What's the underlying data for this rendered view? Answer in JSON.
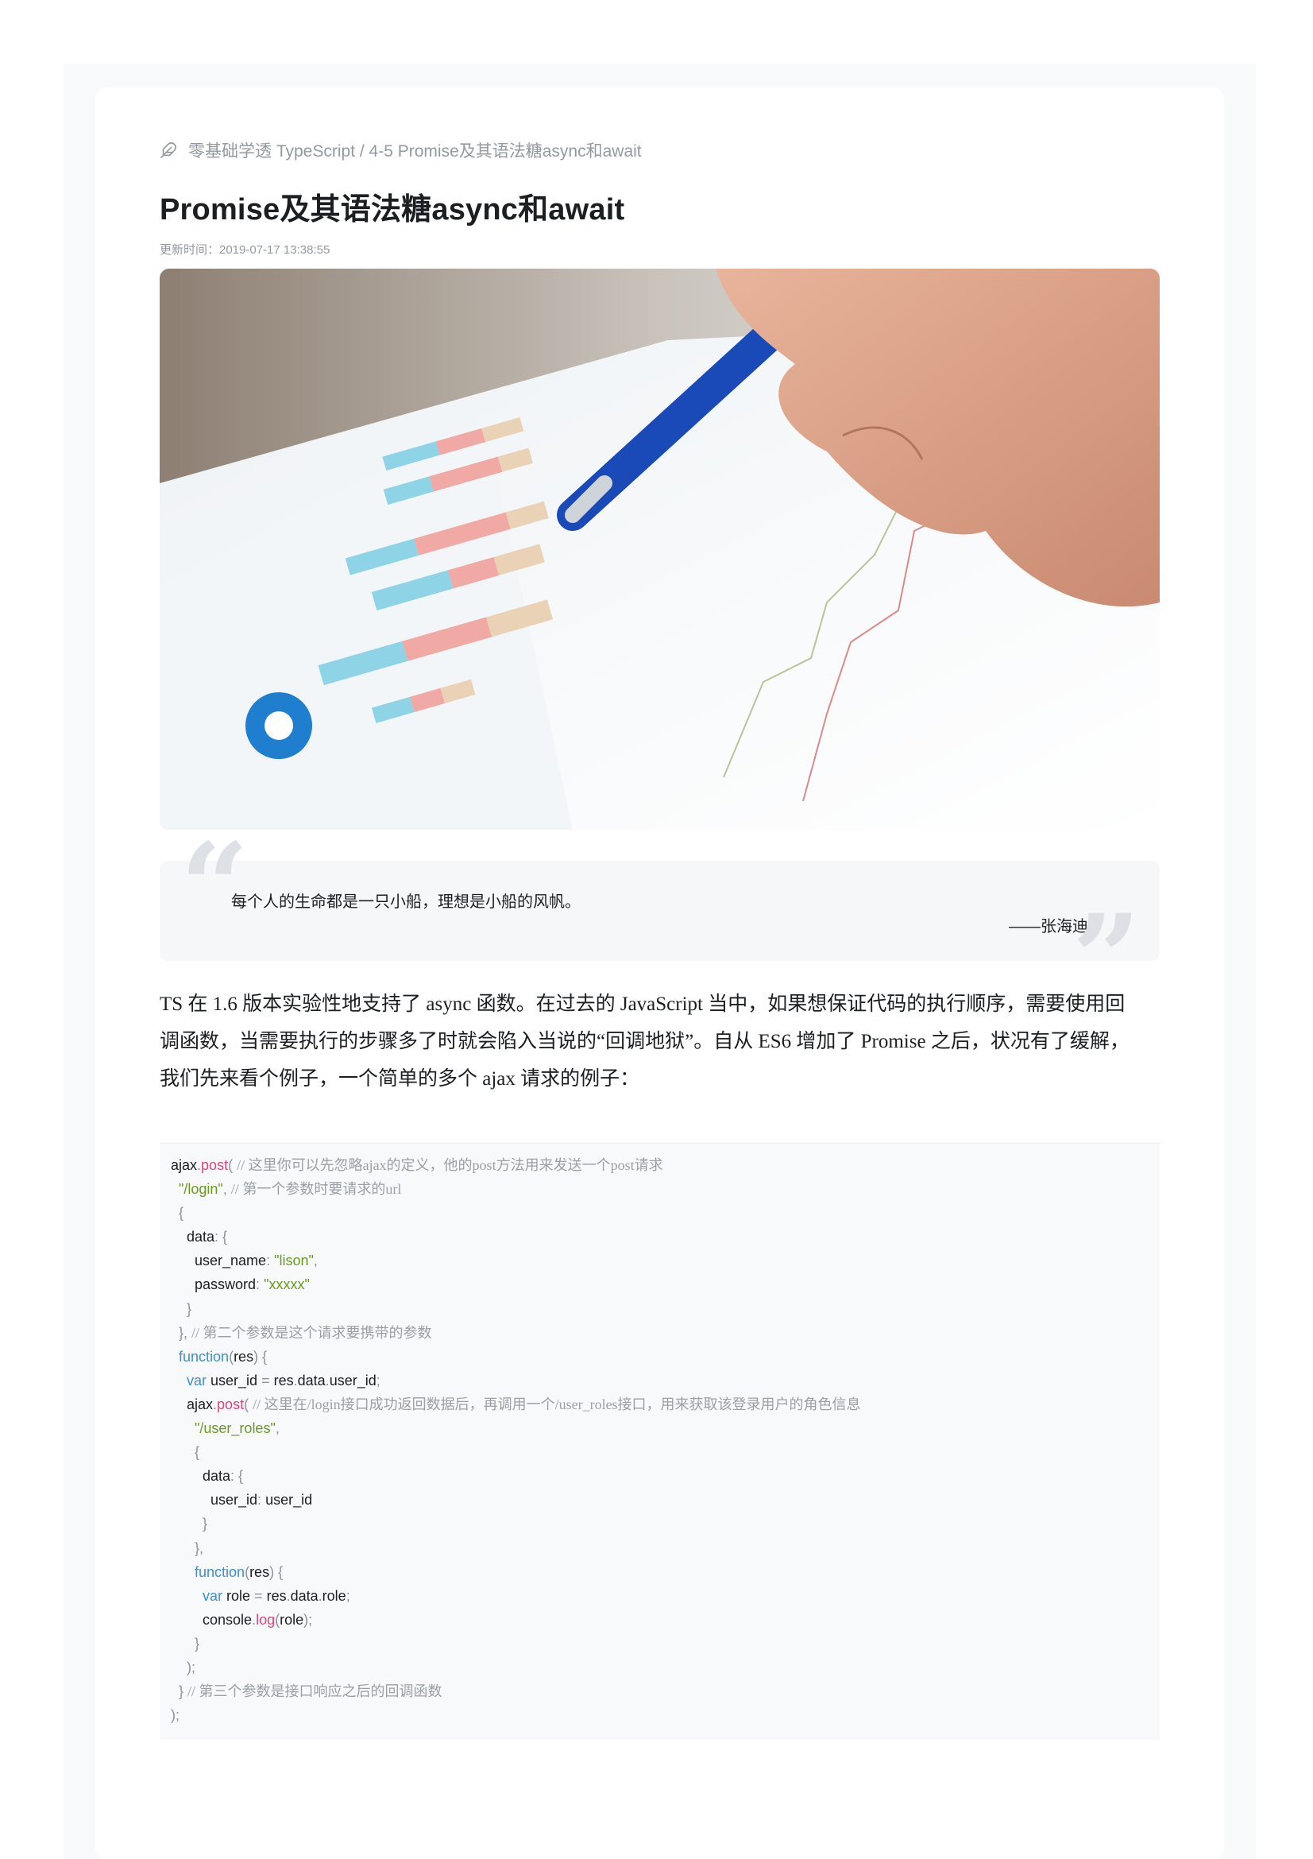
{
  "breadcrumb": {
    "text": "零基础学透 TypeScript / 4-5 Promise及其语法糖async和await"
  },
  "article": {
    "title": "Promise及其语法糖async和await",
    "updated": "更新时间：2019-07-17 13:38:55"
  },
  "quote": {
    "text": "每个人的生命都是一只小船，理想是小船的风帆。",
    "author": "——张海迪"
  },
  "intro": {
    "l1": "TS 在 1.6 版本实验性地支持了 async 函数。在过去的 JavaScript 当中，如果想保证代码的执行顺序，需要使用回",
    "l2": "调函数，当需要执行的步骤多了时就会陷入当说的“回调地狱”。自从 ES6 增加了 Promise 之后，状况有了缓解，",
    "l3": "我们先来看个例子，一个简单的多个 ajax 请求的例子："
  },
  "code": [
    [
      [
        "plain",
        "ajax"
      ],
      [
        "p",
        "."
      ],
      [
        "fn",
        "post"
      ],
      [
        "p",
        "( "
      ],
      [
        "cm",
        "// 这里你可以先忽略ajax的定义，他的post方法用来发送一个post请求"
      ]
    ],
    [
      [
        "plain",
        "  "
      ],
      [
        "str",
        "\"/login\""
      ],
      [
        "p",
        ", "
      ],
      [
        "cm",
        "// 第一个参数时要请求的url"
      ]
    ],
    [
      [
        "plain",
        "  "
      ],
      [
        "p",
        "{"
      ]
    ],
    [
      [
        "plain",
        "    data"
      ],
      [
        "p",
        ": {"
      ]
    ],
    [
      [
        "plain",
        "      user_name"
      ],
      [
        "p",
        ": "
      ],
      [
        "str",
        "\"lison\""
      ],
      [
        "p",
        ","
      ]
    ],
    [
      [
        "plain",
        "      password"
      ],
      [
        "p",
        ": "
      ],
      [
        "str",
        "\"xxxxx\""
      ]
    ],
    [
      [
        "plain",
        "    "
      ],
      [
        "p",
        "}"
      ]
    ],
    [
      [
        "plain",
        "  "
      ],
      [
        "p",
        "}, "
      ],
      [
        "cm",
        "// 第二个参数是这个请求要携带的参数"
      ]
    ],
    [
      [
        "plain",
        "  "
      ],
      [
        "kw",
        "function"
      ],
      [
        "p",
        "("
      ],
      [
        "plain",
        "res"
      ],
      [
        "p",
        ") {"
      ]
    ],
    [
      [
        "plain",
        "    "
      ],
      [
        "kw",
        "var"
      ],
      [
        "plain",
        " user_id "
      ],
      [
        "p",
        "= "
      ],
      [
        "plain",
        "res"
      ],
      [
        "p",
        "."
      ],
      [
        "plain",
        "data"
      ],
      [
        "p",
        "."
      ],
      [
        "plain",
        "user_id"
      ],
      [
        "p",
        ";"
      ]
    ],
    [
      [
        "plain",
        "    ajax"
      ],
      [
        "p",
        "."
      ],
      [
        "fn",
        "post"
      ],
      [
        "p",
        "( "
      ],
      [
        "cm",
        "// 这里在/login接口成功返回数据后，再调用一个/user_roles接口，用来获取该登录用户的角色信息"
      ]
    ],
    [
      [
        "plain",
        "      "
      ],
      [
        "str",
        "\"/user_roles\""
      ],
      [
        "p",
        ","
      ]
    ],
    [
      [
        "plain",
        "      "
      ],
      [
        "p",
        "{"
      ]
    ],
    [
      [
        "plain",
        "        data"
      ],
      [
        "p",
        ": {"
      ]
    ],
    [
      [
        "plain",
        "          user_id"
      ],
      [
        "p",
        ": "
      ],
      [
        "plain",
        "user_id"
      ]
    ],
    [
      [
        "plain",
        "        "
      ],
      [
        "p",
        "}"
      ]
    ],
    [
      [
        "plain",
        "      "
      ],
      [
        "p",
        "},"
      ]
    ],
    [
      [
        "plain",
        "      "
      ],
      [
        "kw",
        "function"
      ],
      [
        "p",
        "("
      ],
      [
        "plain",
        "res"
      ],
      [
        "p",
        ") {"
      ]
    ],
    [
      [
        "plain",
        "        "
      ],
      [
        "kw",
        "var"
      ],
      [
        "plain",
        " role "
      ],
      [
        "p",
        "= "
      ],
      [
        "plain",
        "res"
      ],
      [
        "p",
        "."
      ],
      [
        "plain",
        "data"
      ],
      [
        "p",
        "."
      ],
      [
        "plain",
        "role"
      ],
      [
        "p",
        ";"
      ]
    ],
    [
      [
        "plain",
        "        console"
      ],
      [
        "p",
        "."
      ],
      [
        "fn",
        "log"
      ],
      [
        "p",
        "("
      ],
      [
        "plain",
        "role"
      ],
      [
        "p",
        ");"
      ]
    ],
    [
      [
        "plain",
        "      "
      ],
      [
        "p",
        "}"
      ]
    ],
    [
      [
        "plain",
        "    "
      ],
      [
        "p",
        ");"
      ]
    ],
    [
      [
        "plain",
        "  "
      ],
      [
        "p",
        "} "
      ],
      [
        "cm",
        "// 第三个参数是接口响应之后的回调函数"
      ]
    ],
    [
      [
        "p",
        ");"
      ]
    ]
  ]
}
